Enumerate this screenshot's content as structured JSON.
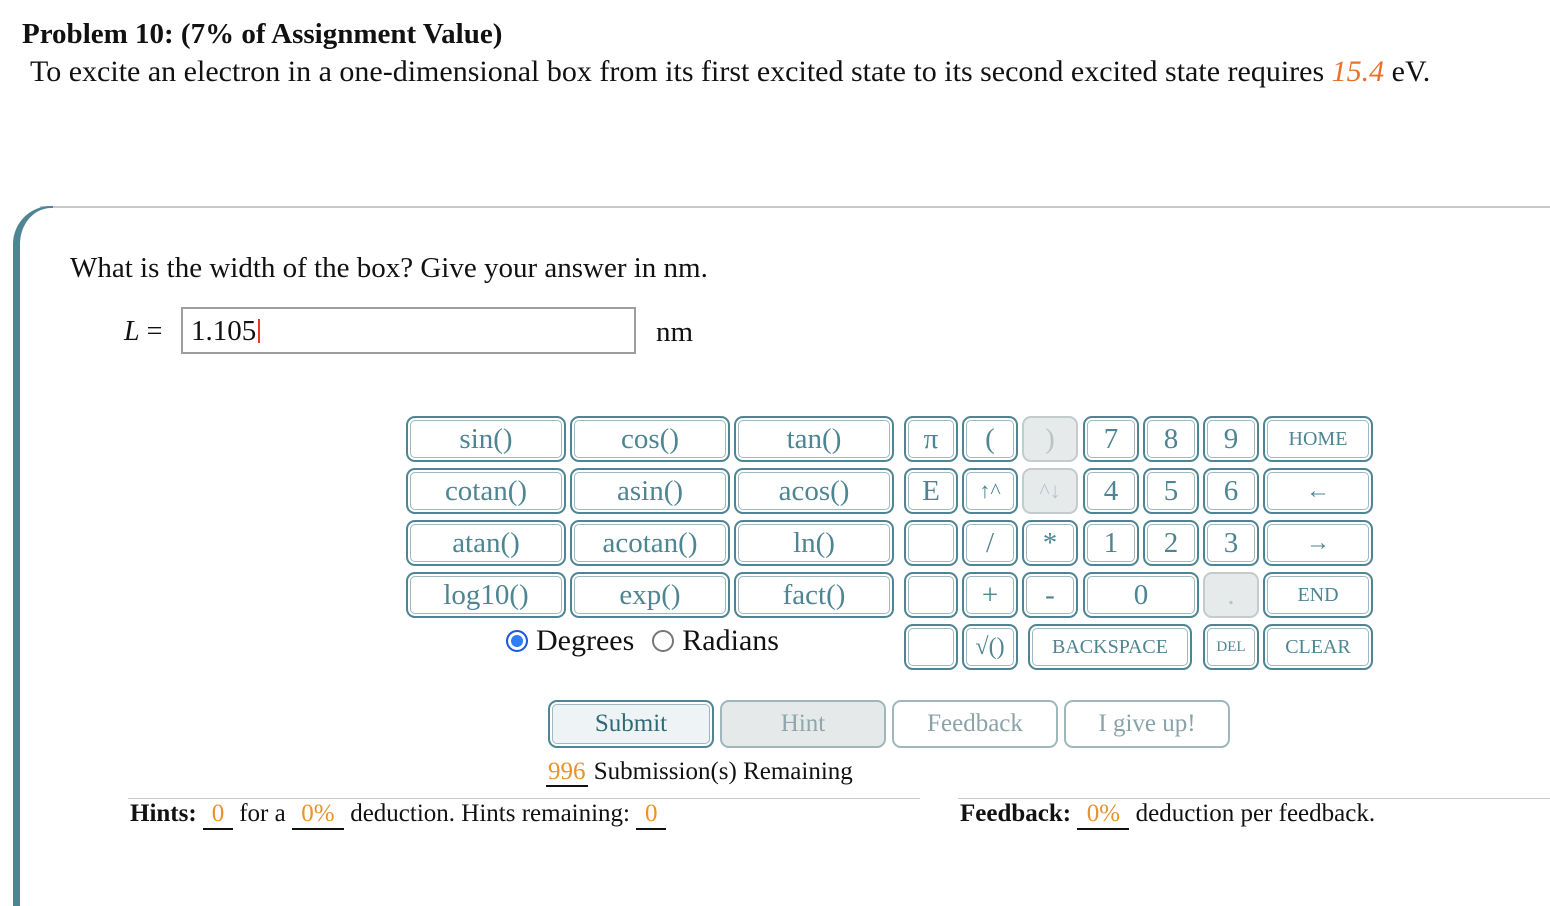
{
  "problem": {
    "header": "Problem 10: (7% of Assignment Value)",
    "text_before": "To excite an electron in a one-dimensional box from its first excited state to its second excited state requires ",
    "energy_value": "15.4",
    "text_after": " eV."
  },
  "question": {
    "prompt": "What is the width of the box? Give your answer in nm.",
    "variable": "L",
    "equals": " = ",
    "answer_value": "1.105",
    "unit": "nm"
  },
  "keypad": {
    "functions": [
      "sin()",
      "cos()",
      "tan()",
      "cotan()",
      "asin()",
      "acos()",
      "atan()",
      "acotan()",
      "ln()",
      "log10()",
      "exp()",
      "fact()"
    ],
    "symbols": [
      "π",
      "(",
      ")",
      "E",
      "↑^",
      "^↓",
      "",
      "/",
      "*",
      "",
      "+",
      "-",
      "",
      "√()"
    ],
    "digits": [
      "7",
      "8",
      "9",
      "4",
      "5",
      "6",
      "1",
      "2",
      "3",
      "0",
      "."
    ],
    "nav": [
      "HOME",
      "←",
      "→",
      "END",
      "CLEAR"
    ],
    "backspace": "BACKSPACE",
    "del": "DEL"
  },
  "angle_mode": {
    "degrees": "Degrees",
    "radians": "Radians",
    "selected": "Degrees"
  },
  "buttons": {
    "submit": "Submit",
    "hint": "Hint",
    "feedback": "Feedback",
    "give_up": "I give up!"
  },
  "status": {
    "submissions_count": "996",
    "submissions_text": " Submission(s) Remaining",
    "hints_label": "Hints:",
    "hints_used": "0",
    "for_a": " for a ",
    "hint_deduction": "0%",
    "hint_deduction_text": " deduction. Hints remaining: ",
    "hints_remaining": "0",
    "feedback_label": "Feedback:",
    "feedback_deduction": "0%",
    "feedback_text": " deduction per feedback."
  },
  "colors": {
    "accent": "#4d8592",
    "highlight": "#e8702a",
    "radio_selected": "#2f7df6"
  }
}
